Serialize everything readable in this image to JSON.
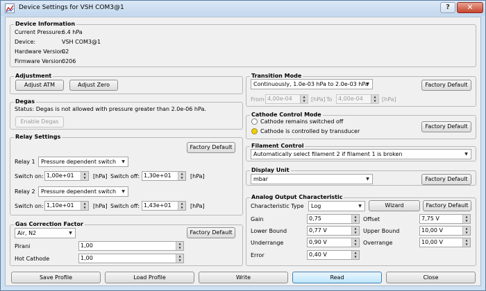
{
  "window": {
    "title": "Device Settings for VSH COM3@1",
    "help_glyph": "?",
    "close_glyph": "✕"
  },
  "device_info": {
    "group_title": "Device Information",
    "rows": [
      {
        "label": "Current Pressure:",
        "value": "6.4 hPa"
      },
      {
        "label": "Device:",
        "value": "VSH COM3@1"
      },
      {
        "label": "Hardware Version:",
        "value": "02"
      },
      {
        "label": "Firmware Version:",
        "value": "0206"
      }
    ]
  },
  "adjustment": {
    "group_title": "Adjustment",
    "atm_label": "Adjust ATM",
    "zero_label": "Adjust Zero"
  },
  "degas": {
    "group_title": "Degas",
    "status": "Status:  Degas is not allowed with pressure greater than 2.0e-06 hPa.",
    "enable_label": "Enable Degas"
  },
  "relay": {
    "group_title": "Relay Settings",
    "factory_label": "Factory Default",
    "relays": [
      {
        "label": "Relay 1",
        "mode": "Pressure dependent switch",
        "switch_on_label": "Switch on:",
        "switch_on": "1,00e+01",
        "unit_on": "[hPa]",
        "switch_off_label": "Switch off:",
        "switch_off": "1,30e+01",
        "unit_off": "[hPa]"
      },
      {
        "label": "Relay 2",
        "mode": "Pressure dependent switch",
        "switch_on_label": "Switch on:",
        "switch_on": "1,10e+01",
        "unit_on": "[hPa]",
        "switch_off_label": "Switch off:",
        "switch_off": "1,43e+01",
        "unit_off": "[hPa]"
      }
    ]
  },
  "gas": {
    "group_title": "Gas Correction Factor",
    "gas": "Air, N2",
    "factory_label": "Factory Default",
    "pirani_label": "Pirani",
    "pirani": "1,00",
    "hotcathode_label": "Hot Cathode",
    "hotcathode": "1,00"
  },
  "transition": {
    "group_title": "Transition Mode",
    "mode": "Continuously, 1.0e-03 hPa to 2.0e-03 hPa",
    "factory_label": "Factory Default",
    "from_label": "From",
    "from": "4,00e-04",
    "from_unit": "[hPa]",
    "to_label": "To",
    "to": "4,00e-04",
    "to_unit": "[hPa]"
  },
  "cathode": {
    "group_title": "Cathode Control Mode",
    "opt1": "Cathode remains switched off",
    "opt2": "Cathode is controlled by transducer",
    "factory_label": "Factory Default"
  },
  "filament": {
    "group_title": "Filament Control",
    "mode": "Automatically select filament 2 if filament 1 is broken"
  },
  "display": {
    "group_title": "Display Unit",
    "unit": "mbar",
    "factory_label": "Factory Default"
  },
  "analog": {
    "group_title": "Analog Output Characteristic",
    "char_label": "Characteristic Type",
    "char": "Log",
    "wizard_label": "Wizard",
    "factory_label": "Factory Default",
    "gain_label": "Gain",
    "gain": "0,75",
    "offset_label": "Offset",
    "offset": "7,75 V",
    "lower_label": "Lower Bound",
    "lower": "0,77 V",
    "upper_label": "Upper Bound",
    "upper": "10,00 V",
    "under_label": "Underrange",
    "under": "0,90 V",
    "over_label": "Overrange",
    "over": "10,00 V",
    "error_label": "Error",
    "error": "0,40 V"
  },
  "footer": {
    "save": "Save Profile",
    "load": "Load Profile",
    "write": "Write",
    "read": "Read",
    "close": "Close"
  },
  "colors": {
    "accent": "#3c7fb1",
    "radio_selected": "#f0d000",
    "close_button": "#c7432c"
  }
}
